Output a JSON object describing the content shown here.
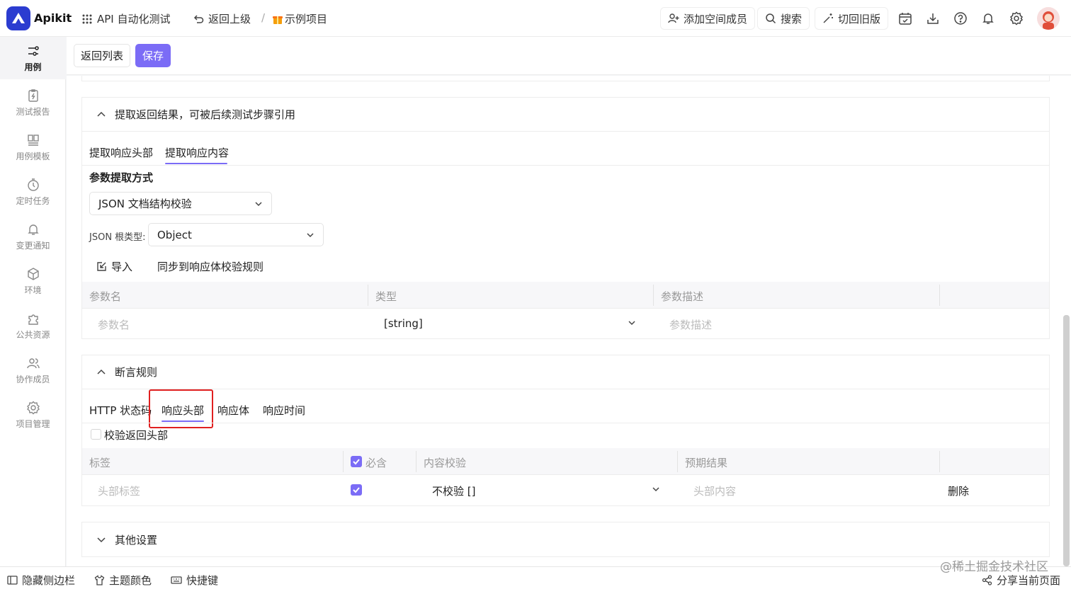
{
  "app": {
    "name": "Apikit",
    "section": "API 自动化测试",
    "back_label": "返回上级",
    "separator": "/",
    "project": "示例项目"
  },
  "header_actions": {
    "add_member": "添加空间成员",
    "search": "搜索",
    "switch_old": "切回旧版"
  },
  "sidebar": {
    "items": [
      {
        "label": "用例",
        "icon": "test-case-icon",
        "active": true
      },
      {
        "label": "测试报告",
        "icon": "report-icon"
      },
      {
        "label": "用例模板",
        "icon": "template-icon"
      },
      {
        "label": "定时任务",
        "icon": "timer-icon"
      },
      {
        "label": "变更通知",
        "icon": "bell-icon"
      },
      {
        "label": "环境",
        "icon": "cube-icon"
      },
      {
        "label": "公共资源",
        "icon": "puzzle-icon"
      },
      {
        "label": "协作成员",
        "icon": "users-icon"
      },
      {
        "label": "项目管理",
        "icon": "gear-icon"
      }
    ]
  },
  "toolbar": {
    "back_list": "返回列表",
    "save": "保存"
  },
  "extract": {
    "title": "提取返回结果，可被后续测试步骤引用",
    "tabs": [
      "提取响应头部",
      "提取响应内容"
    ],
    "active_tab": "提取响应内容",
    "method_label": "参数提取方式",
    "method_value": "JSON 文档结构校验",
    "root_type_label": "JSON 根类型:",
    "root_type_value": "Object",
    "import_label": "导入",
    "sync_label": "同步到响应体校验规则",
    "columns": [
      "参数名",
      "类型",
      "参数描述"
    ],
    "row": {
      "name_placeholder": "参数名",
      "type": "[string]",
      "desc_placeholder": "参数描述"
    }
  },
  "assert": {
    "title": "断言规则",
    "tabs": [
      "HTTP 状态码",
      "响应头部",
      "响应体",
      "响应时间"
    ],
    "active_tab": "响应头部",
    "verify_label": "校验返回头部",
    "columns": [
      "标签",
      "必含",
      "内容校验",
      "预期结果"
    ],
    "row": {
      "label_placeholder": "头部标签",
      "required": true,
      "validation": "不校验 []",
      "expected_placeholder": "头部内容",
      "delete": "删除"
    }
  },
  "other": {
    "title": "其他设置"
  },
  "bottom": {
    "hide_sidebar": "隐藏侧边栏",
    "theme": "主题颜色",
    "shortcuts": "快捷键",
    "share": "分享当前页面"
  },
  "watermark": "@稀土掘金技术社区",
  "colors": {
    "accent": "#7b6cf6",
    "brand": "#2b3cd0",
    "highlight": "#e02020"
  }
}
